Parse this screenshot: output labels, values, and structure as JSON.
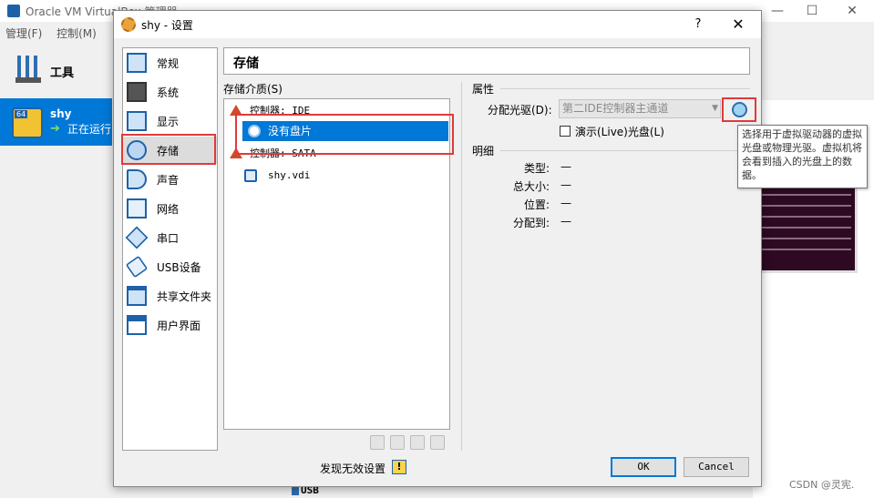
{
  "main_window": {
    "title": "Oracle VM VirtualBox 管理器",
    "minimize": "—",
    "maximize": "☐",
    "close": "✕",
    "menu": [
      "管理(F)",
      "控制(M)"
    ],
    "tools_label": "工具",
    "vm": {
      "bits": "64",
      "name": "shy",
      "state": "正在运行"
    },
    "bottom_label": "USB"
  },
  "dialog": {
    "title": "shy - 设置",
    "help": "?",
    "close": "✕",
    "sidebar": [
      {
        "label": "常规",
        "icon": "monitor-icon"
      },
      {
        "label": "系统",
        "icon": "chip-icon"
      },
      {
        "label": "显示",
        "icon": "display-icon"
      },
      {
        "label": "存储",
        "icon": "storage-icon",
        "selected": true
      },
      {
        "label": "声音",
        "icon": "speaker-icon"
      },
      {
        "label": "网络",
        "icon": "network-icon"
      },
      {
        "label": "串口",
        "icon": "serial-icon"
      },
      {
        "label": "USB设备",
        "icon": "usb-icon"
      },
      {
        "label": "共享文件夹",
        "icon": "folder-icon"
      },
      {
        "label": "用户界面",
        "icon": "ui-icon"
      }
    ],
    "page_title": "存储",
    "storage": {
      "media_label": "存储介质(S)",
      "tree": [
        {
          "label": "控制器: IDE",
          "type": "controller"
        },
        {
          "label": "没有盘片",
          "type": "disc",
          "selected": true
        },
        {
          "label": "控制器: SATA",
          "type": "controller"
        },
        {
          "label": "shy.vdi",
          "type": "harddisk"
        }
      ]
    },
    "attributes": {
      "heading": "属性",
      "drive_label": "分配光驱(D):",
      "drive_value": "第二IDE控制器主通道",
      "live_label": "演示(Live)光盘(L)"
    },
    "details": {
      "heading": "明细",
      "rows": [
        {
          "label": "类型:",
          "value": "—"
        },
        {
          "label": "总大小:",
          "value": "—"
        },
        {
          "label": "位置:",
          "value": "—"
        },
        {
          "label": "分配到:",
          "value": "—"
        }
      ]
    },
    "tooltip": "选择用于虚拟驱动器的虚拟光盘或物理光驱。虚拟机将会看到插入的光盘上的数据。",
    "warning_text": "发现无效设置",
    "warning_icon": "!",
    "ok_label": "OK",
    "cancel_label": "Cancel"
  },
  "watermark": "CSDN @灵宪."
}
